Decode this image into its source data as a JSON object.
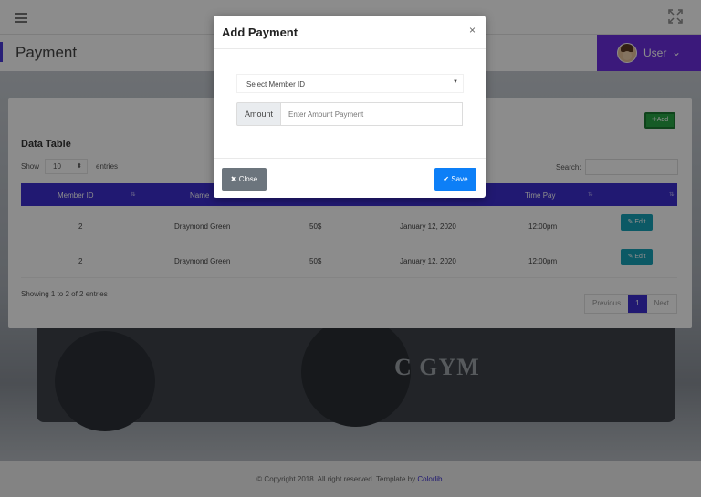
{
  "header": {
    "page_title": "Payment",
    "user_label": "User",
    "user_chevron": "⌄"
  },
  "card": {
    "add_label": "✚Add",
    "title": "Data Table",
    "show_label": "Show",
    "entries_value": "10",
    "entries_label": "entries",
    "search_label": "Search:",
    "columns": [
      "Member ID",
      "Name",
      "Time Pay"
    ],
    "rows": [
      {
        "member_id": "2",
        "name": "Draymond Green",
        "amount": "50$",
        "date": "January 12, 2020",
        "time": "12:00pm",
        "edit_label": "✎ Edit"
      },
      {
        "member_id": "2",
        "name": "Draymond Green",
        "amount": "50$",
        "date": "January 12, 2020",
        "time": "12:00pm",
        "edit_label": "✎ Edit"
      }
    ],
    "showing_text": "Showing 1 to 2 of 2 entries",
    "pager": {
      "previous": "Previous",
      "current": "1",
      "next": "Next"
    }
  },
  "hero": {
    "text": "C GYM"
  },
  "footer": {
    "text": "© Copyright 2018. All right reserved. Template by ",
    "link": "Colorlib."
  },
  "modal": {
    "title": "Add Payment",
    "close_icon": "×",
    "member_select_value": "Select Member ID",
    "amount_label": "Amount",
    "amount_placeholder": "Enter Amount Payment",
    "close_label": "✖ Close",
    "save_label": "✔ Save"
  },
  "colors": {
    "primary": "#3c2fcf",
    "user_box": "#6c2ee0",
    "add": "#28a745",
    "edit": "#17a2b8",
    "save": "#0d7ff7",
    "close": "#6c757d"
  }
}
